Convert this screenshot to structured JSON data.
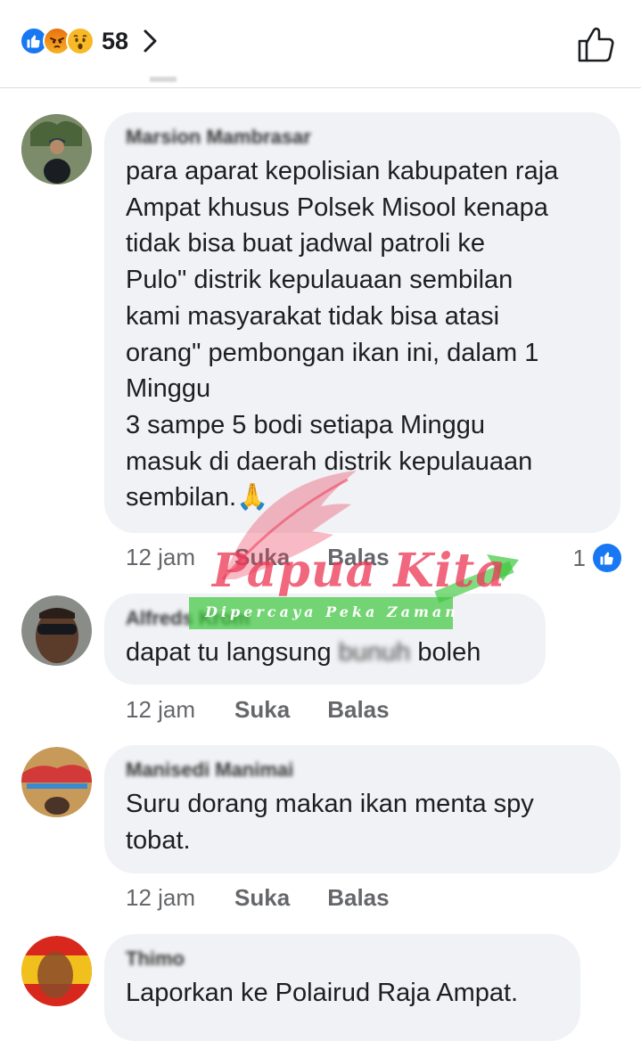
{
  "header": {
    "reaction_count": "58",
    "reactions": [
      "like",
      "angry",
      "wow"
    ]
  },
  "comments": [
    {
      "author": "Marsion Mambrasar",
      "text": "para aparat kepolisian kabupaten raja\nAmpat khusus Polsek Misool kenapa\ntidak bisa buat jadwal patroli  ke\nPulo\" distrik kepulauaan sembilan\nkami masyarakat tidak bisa atasi\norang\" pembongan ikan ini, dalam 1\nMinggu\n 3 sampe 5 bodi setiapa Minggu\nmasuk di daerah distrik kepulauaan\nsembilan.🙏",
      "time": "12 jam",
      "like_label": "Suka",
      "reply_label": "Balas",
      "like_count": "1"
    },
    {
      "author": "Alfreds Krom",
      "text_before": "dapat tu langsung ",
      "text_blurred": "bunuh",
      "text_after": " boleh",
      "time": "12 jam",
      "like_label": "Suka",
      "reply_label": "Balas"
    },
    {
      "author": "Manisedi Manimai",
      "text": "Suru dorang makan ikan menta  spy\ntobat.",
      "time": "12 jam",
      "like_label": "Suka",
      "reply_label": "Balas"
    },
    {
      "author": "Thimo",
      "text": "Laporkan ke Polairud Raja Ampat."
    }
  ],
  "watermark": {
    "title": "Papua Kita",
    "tagline": "Dipercaya Peka Zaman"
  },
  "colors": {
    "accent": "#1877f2",
    "bubble": "#f0f2f5",
    "meta": "#65676b",
    "watermark_red": "#ec3c5a",
    "watermark_green": "#3cc83c"
  }
}
